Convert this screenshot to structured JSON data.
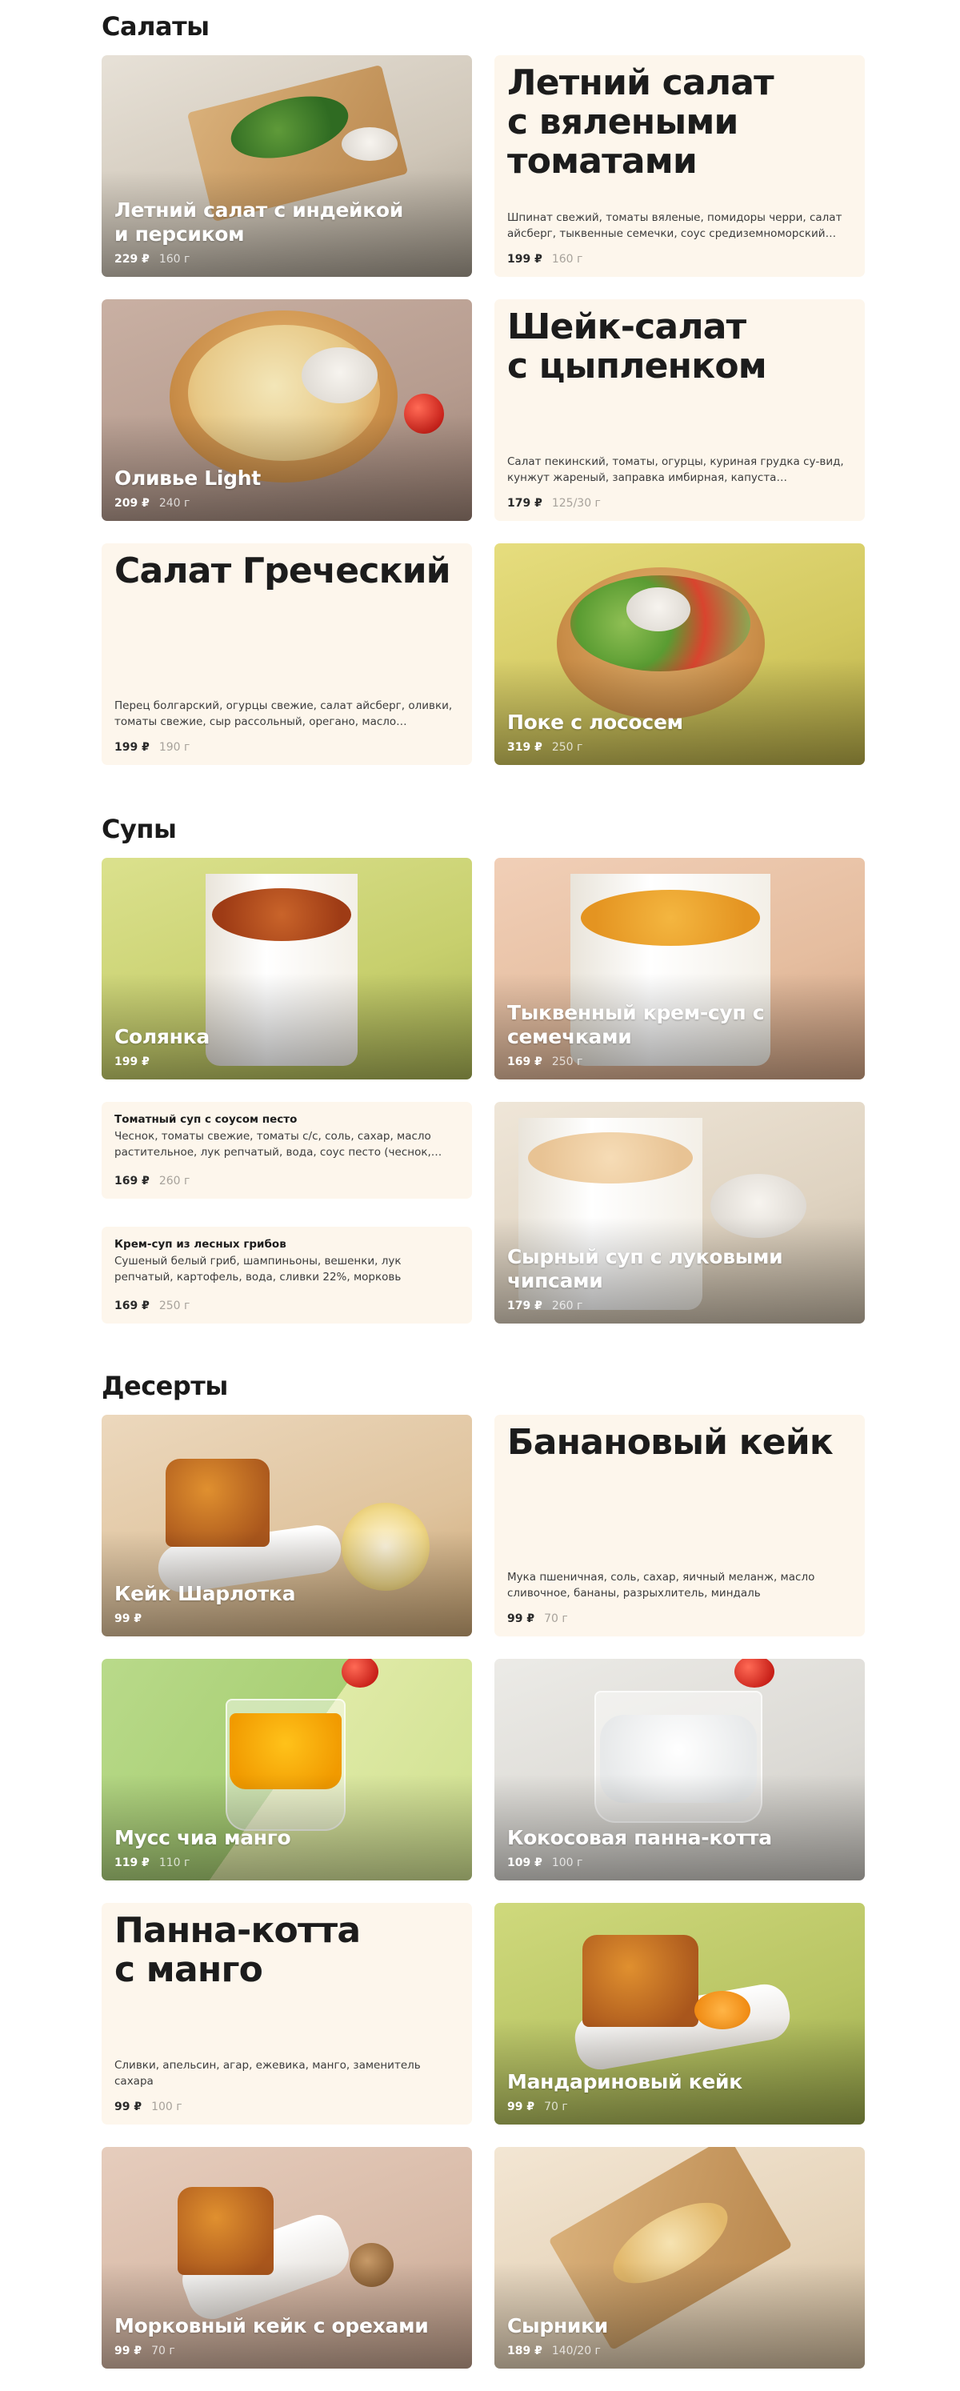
{
  "sections": {
    "salads": {
      "title": "Салаты",
      "items": [
        {
          "name": "Летний салат с индейкой\nи персиком",
          "price": "229 ₽",
          "weight": "160 г"
        },
        {
          "name": "Летний салат\nс вялеными\nтоматами",
          "description": "Шпинат свежий, томаты вяленые, помидоры черри, салат айсберг, тыквенные семечки, соус средиземноморский…",
          "price": "199 ₽",
          "weight": "160 г"
        },
        {
          "name": "Оливье Light",
          "price": "209 ₽",
          "weight": "240 г"
        },
        {
          "name": "Шейк-салат\nс цыпленком",
          "description": "Салат пекинский, томаты, огурцы, куриная грудка су-вид, кунжут жареный, заправка имбирная, капуста краснокоча…",
          "price": "179 ₽",
          "weight": "125/30 г"
        },
        {
          "name": "Салат Греческий",
          "description": "Перец болгарский, огурцы свежие, салат айсберг, оливки, томаты свежие, сыр рассольный, орегано, масло оливковк…",
          "price": "199 ₽",
          "weight": "190 г"
        },
        {
          "name": "Поке с лососем",
          "price": "319 ₽",
          "weight": "250 г"
        }
      ]
    },
    "soups": {
      "title": "Супы",
      "items": [
        {
          "name": "Солянка",
          "price": "199 ₽",
          "weight": ""
        },
        {
          "name": "Тыквенный крем-суп с семечками",
          "price": "169 ₽",
          "weight": "250 г"
        },
        {
          "name": "Томатный суп с соусом песто",
          "description": "Чеснок, томаты свежие, томаты с/с, соль, сахар, масло растительное, лук репчатый, вода, соус песто (чеснок, оре…",
          "price": "169 ₽",
          "weight": "260 г"
        },
        {
          "name": "Крем-суп из лесных грибов",
          "description": "Сушеный белый гриб, шампиньоны, вешенки, лук репчатый, картофель, вода, сливки 22%, морковь",
          "price": "169 ₽",
          "weight": "250 г"
        },
        {
          "name": "Сырный суп с луковыми чипсами",
          "price": "179 ₽",
          "weight": "260 г"
        }
      ]
    },
    "desserts": {
      "title": "Десерты",
      "items": [
        {
          "name": "Кейк Шарлотка",
          "price": "99 ₽",
          "weight": ""
        },
        {
          "name": "Банановый кейк",
          "description": "Мука пшеничная, соль, сахар, яичный меланж, масло сливочное, бананы, разрыхлитель, миндаль",
          "price": "99 ₽",
          "weight": "70 г"
        },
        {
          "name": "Мусс чиа манго",
          "price": "119 ₽",
          "weight": "110 г"
        },
        {
          "name": "Кокосовая панна-котта",
          "price": "109 ₽",
          "weight": "100 г"
        },
        {
          "name": "Панна-котта\nс манго",
          "description": "Сливки, апельсин, агар, ежевика, манго, заменитель сахара",
          "price": "99 ₽",
          "weight": "100 г"
        },
        {
          "name": "Мандариновый кейк",
          "price": "99 ₽",
          "weight": "70 г"
        },
        {
          "name": "Морковный кейк с орехами",
          "price": "99 ₽",
          "weight": "70 г"
        },
        {
          "name": "Сырники",
          "price": "189 ₽",
          "weight": "140/20 г"
        }
      ]
    }
  },
  "colors": {
    "text_card_bg": "#fdf6ec",
    "heading": "#1a1a1a",
    "muted": "#a7a29b"
  }
}
